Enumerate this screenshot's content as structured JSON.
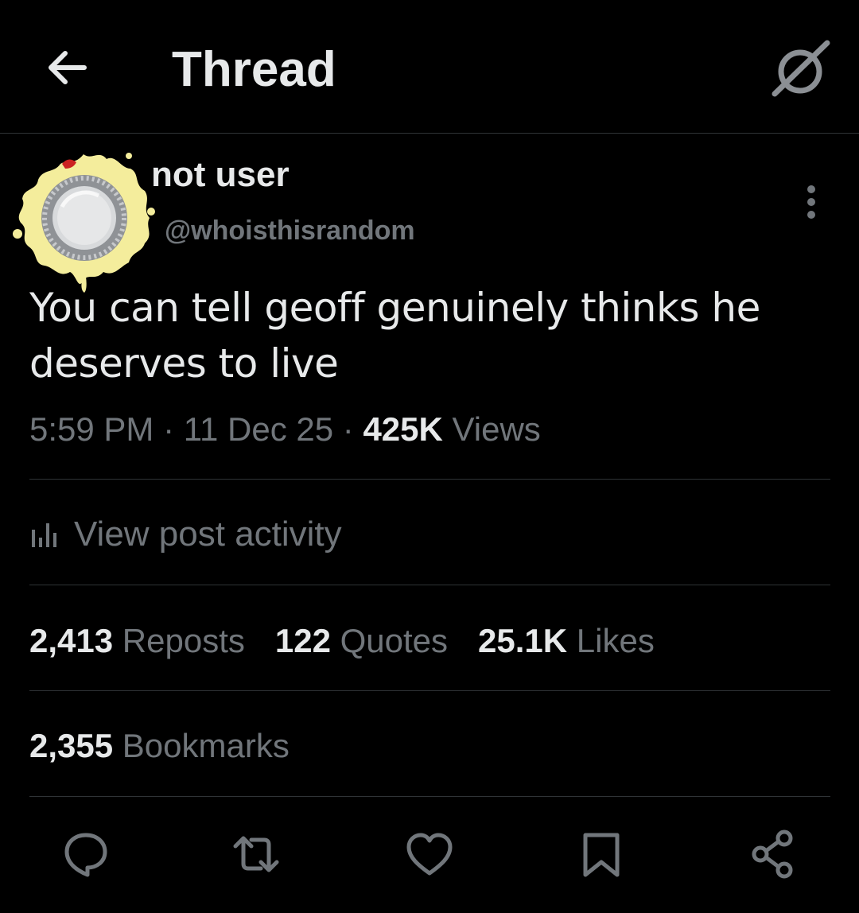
{
  "header": {
    "title": "Thread",
    "back_icon": "arrow-left-icon",
    "grok_icon": "grok-icon"
  },
  "post": {
    "author": {
      "display_name": "not user",
      "handle": "@whoisthisrandom",
      "avatar": "avatar-image"
    },
    "text": "You can tell geoff genuinely thinks he deserves to live",
    "time": "5:59 PM",
    "separator": "·",
    "date": "11 Dec 25",
    "views_count": "425K",
    "views_label": "Views"
  },
  "activity": {
    "label": "View post activity",
    "icon": "analytics-icon"
  },
  "stats": {
    "reposts_count": "2,413",
    "reposts_label": "Reposts",
    "quotes_count": "122",
    "quotes_label": "Quotes",
    "likes_count": "25.1K",
    "likes_label": "Likes",
    "bookmarks_count": "2,355",
    "bookmarks_label": "Bookmarks"
  },
  "actions": [
    "reply-icon",
    "repost-icon",
    "like-icon",
    "bookmark-icon",
    "share-icon"
  ],
  "colors": {
    "background": "#000000",
    "primary_text": "#e7e9ea",
    "secondary_text": "#71767b",
    "divider": "#2f3336"
  }
}
